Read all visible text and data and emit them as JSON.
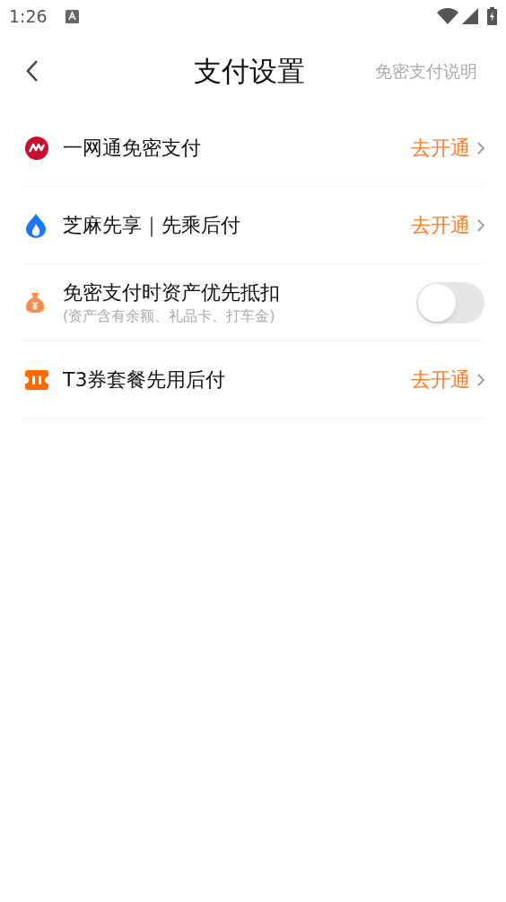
{
  "status_bar": {
    "time": "1:26"
  },
  "header": {
    "title": "支付设置",
    "action": "免密支付说明"
  },
  "rows": [
    {
      "kind": "link",
      "label": "一网通免密支付",
      "action": "去开通"
    },
    {
      "kind": "link",
      "label": "芝麻先享｜先乘后付",
      "action": "去开通"
    },
    {
      "kind": "toggle",
      "label": "免密支付时资产优先抵扣",
      "sublabel": "(资产含有余额、礼品卡、打车金)",
      "on": false
    },
    {
      "kind": "link",
      "label": "T3券套餐先用后付",
      "action": "去开通"
    }
  ]
}
